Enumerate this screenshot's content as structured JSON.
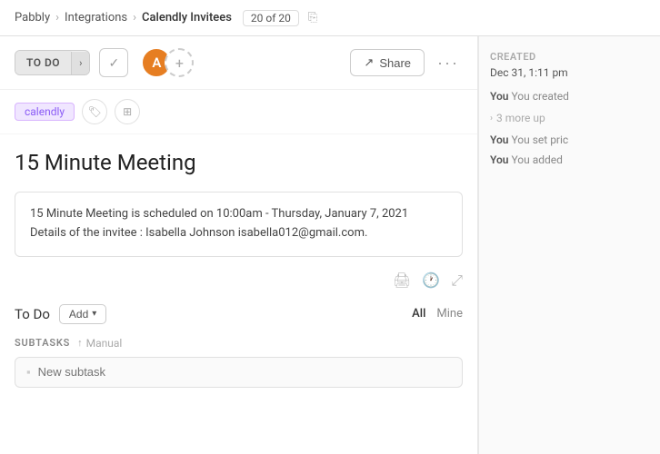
{
  "topbar": {
    "app_name": "Pabbly",
    "breadcrumb_1": "Integrations",
    "breadcrumb_2": "Calendly Invitees",
    "count_current": "20",
    "count_total": "20"
  },
  "toolbar": {
    "status_label": "TO DO",
    "check_symbol": "✓",
    "avatar_initial": "A",
    "add_member_symbol": "+",
    "share_label": "Share"
  },
  "tags": {
    "calendly_label": "calendly"
  },
  "task": {
    "title": "15 Minute Meeting",
    "description_line1": "15 Minute Meeting is scheduled on 10:00am - Thursday, January 7, 2021",
    "description_line2": "Details of the invitee : Isabella Johnson isabella012@gmail.com."
  },
  "todo_section": {
    "label": "To Do",
    "add_button": "Add",
    "filter_all": "All",
    "filter_mine": "Mine"
  },
  "subtasks": {
    "section_label": "SUBTASKS",
    "sort_label": "Manual",
    "input_placeholder": "New subtask"
  },
  "sidebar": {
    "created_label": "CREATED",
    "created_date": "Dec 31, 1:11 pm",
    "activity_1": "You created",
    "activity_more": "3 more up",
    "activity_2": "You set pric",
    "activity_3": "You added"
  }
}
